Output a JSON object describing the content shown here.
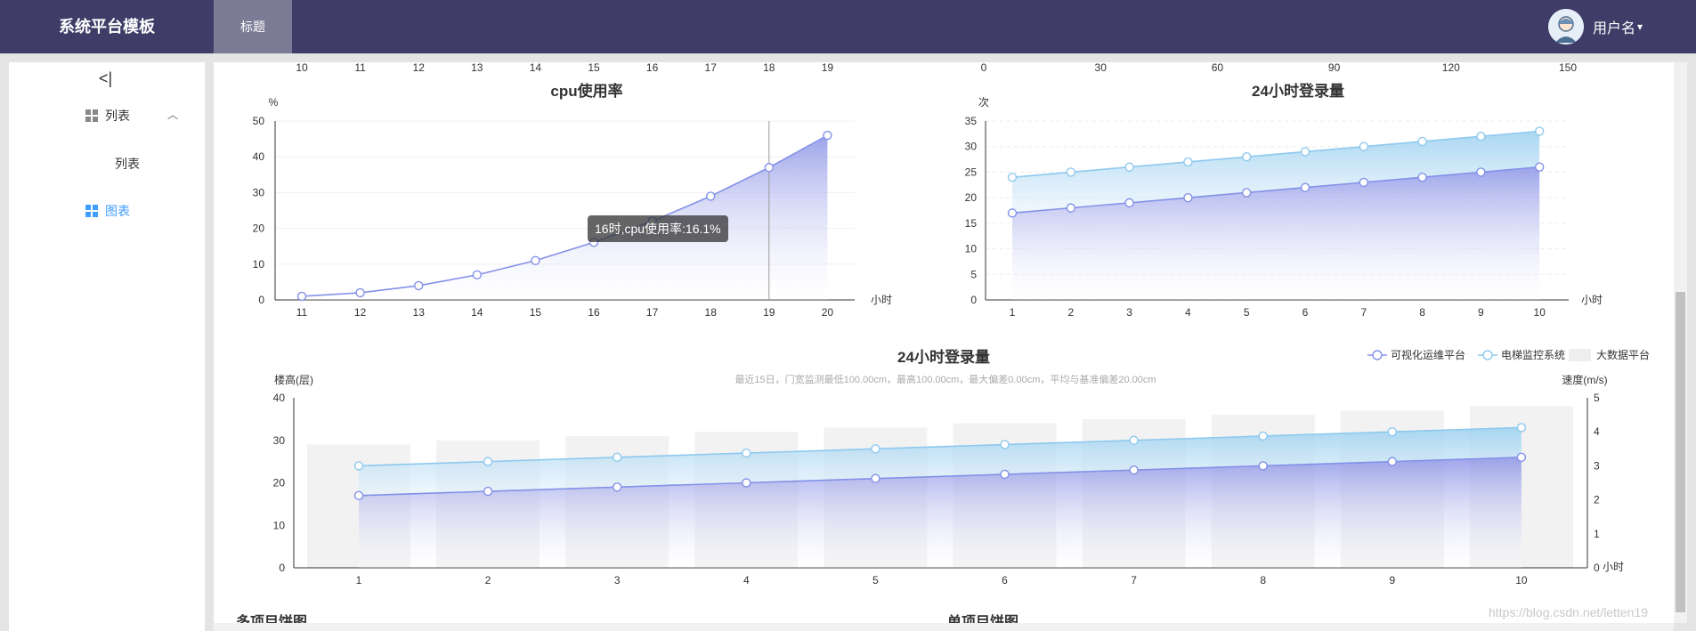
{
  "header": {
    "brand": "系统平台模板",
    "tab": "标题",
    "user": "用户名",
    "user_caret": "▾"
  },
  "sidebar": {
    "collapse_glyph": "<|",
    "menu_caret": "︿",
    "items": [
      {
        "label": "列表",
        "icon": "grid-icon"
      },
      {
        "label": "列表",
        "icon": ""
      },
      {
        "label": "图表",
        "icon": "grid-icon"
      }
    ]
  },
  "tooltip": "16时,cpu使用率:16.1%",
  "watermark": "https://blog.csdn.net/letten19",
  "below_titles": [
    "多项目饼图",
    "单项目饼图"
  ],
  "charts": {
    "cpu": {
      "title": "cpu使用率",
      "unit_y": "%",
      "unit_x": "小时",
      "top_ticks": [
        "10",
        "11",
        "12",
        "13",
        "14",
        "15",
        "16",
        "17",
        "18",
        "19"
      ],
      "x": [
        "11",
        "12",
        "13",
        "14",
        "15",
        "16",
        "17",
        "18",
        "19",
        "20"
      ],
      "y": [
        1,
        2,
        4,
        7,
        11,
        16.1,
        22,
        29,
        37,
        46
      ],
      "ylim": [
        0,
        50
      ],
      "y_ticks": [
        "0",
        "10",
        "20",
        "30",
        "40",
        "50"
      ],
      "pointer_x": "19"
    },
    "login": {
      "title": "24小时登录量",
      "unit_y": "次",
      "unit_x": "小时",
      "top_ticks": [
        "0",
        "30",
        "60",
        "90",
        "120",
        "150"
      ],
      "x": [
        "1",
        "2",
        "3",
        "4",
        "5",
        "6",
        "7",
        "8",
        "9",
        "10"
      ],
      "series_a": [
        17,
        18,
        19,
        20,
        21,
        22,
        23,
        24,
        25,
        26
      ],
      "series_b": [
        24,
        25,
        26,
        27,
        28,
        29,
        30,
        31,
        32,
        33
      ],
      "ylim": [
        0,
        35
      ],
      "y_ticks": [
        "0",
        "5",
        "10",
        "15",
        "20",
        "25",
        "30",
        "35"
      ]
    },
    "combo": {
      "title": "24小时登录量",
      "subtitle": "最近15日，门宽监测最低100.00cm，最高100.00cm，最大偏差0.00cm，平均与基准偏差20.00cm",
      "y_left_label": "楼高(层)",
      "y_right_label": "速度(m/s)",
      "x_unit": "小时",
      "legend": [
        "可视化运维平台",
        "电梯监控系统",
        "大数据平台"
      ],
      "x": [
        "1",
        "2",
        "3",
        "4",
        "5",
        "6",
        "7",
        "8",
        "9",
        "10"
      ],
      "series_a": [
        17,
        18,
        19,
        20,
        21,
        22,
        23,
        24,
        25,
        26
      ],
      "series_b": [
        24,
        25,
        26,
        27,
        28,
        29,
        30,
        31,
        32,
        33
      ],
      "bars": [
        29,
        30,
        31,
        32,
        33,
        34,
        35,
        36,
        37,
        38
      ],
      "ylim_left": [
        0,
        40
      ],
      "ylim_right": [
        0,
        5
      ],
      "y_left_ticks": [
        "0",
        "10",
        "20",
        "30",
        "40"
      ],
      "y_right_ticks": [
        "0",
        "1",
        "2",
        "3",
        "4",
        "5"
      ]
    }
  },
  "colors": {
    "header_bg": "#3f3d68",
    "tab_bg": "#7c7b95",
    "line_blue": "#8391e8",
    "line_light": "#8ec9ee",
    "active": "#409eff"
  }
}
